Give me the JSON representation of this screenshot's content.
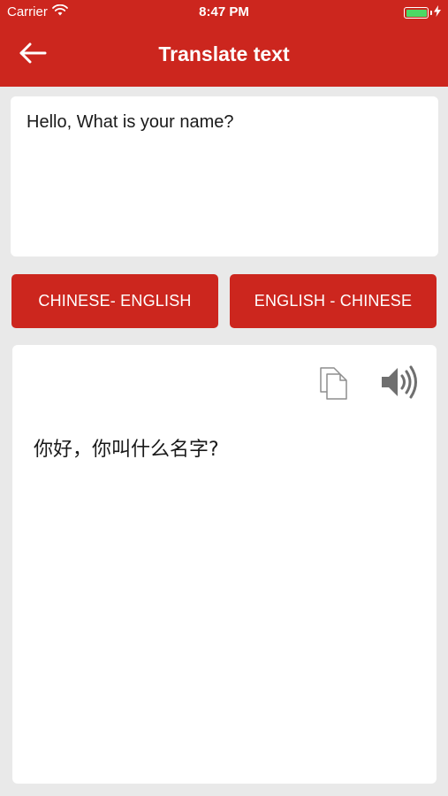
{
  "status_bar": {
    "carrier": "Carrier",
    "time": "8:47 PM",
    "battery_color": "#4cd964",
    "wifi_icon": "wifi-icon",
    "charging_icon": "bolt-icon"
  },
  "header": {
    "title": "Translate text",
    "back_icon": "arrow-left-icon",
    "background_color": "#cc261e"
  },
  "input": {
    "value": "Hello, What is your name?"
  },
  "buttons": {
    "chinese_english": "CHINESE- ENGLISH",
    "english_chinese": "ENGLISH - CHINESE"
  },
  "output": {
    "text": "你好，你叫什么名字?",
    "copy_icon": "copy-icon",
    "speaker_icon": "speaker-icon"
  }
}
